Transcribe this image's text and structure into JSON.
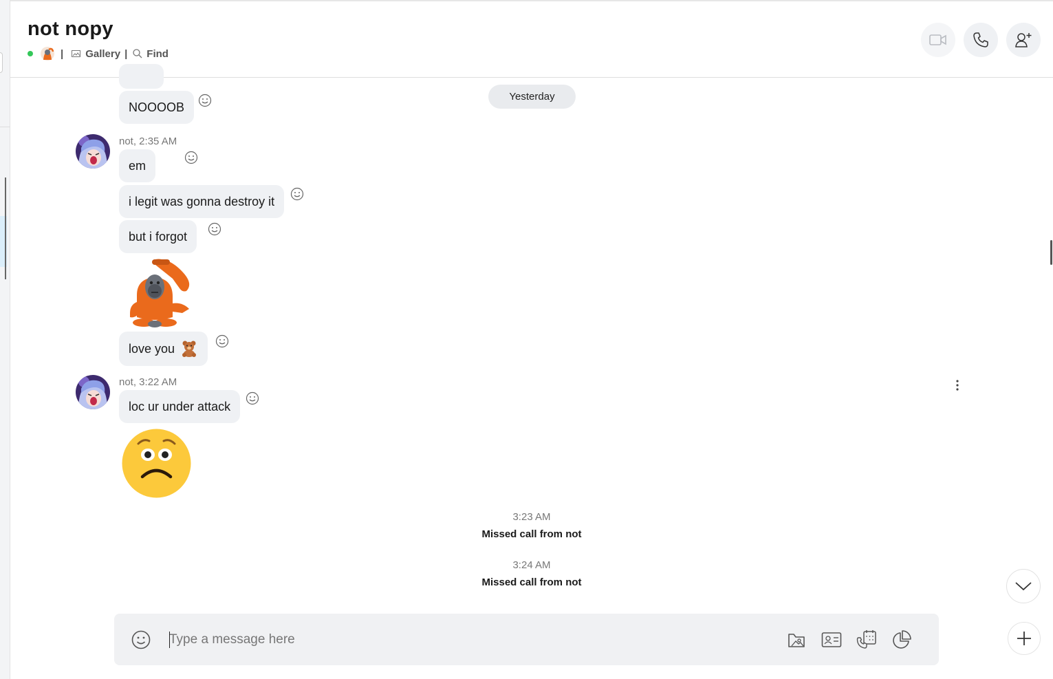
{
  "header": {
    "title": "not nopy",
    "separator": "|",
    "gallery_label": "Gallery",
    "find_label": "Find",
    "status_color": "#34c759",
    "buttons": [
      "video-call-icon",
      "audio-call-icon",
      "add-people-icon"
    ]
  },
  "chat": {
    "date_divider": "Yesterday",
    "messages": [
      {
        "text": "NOOOOB"
      },
      {
        "meta": "not, 2:35 AM"
      },
      {
        "text": "em"
      },
      {
        "text": "i legit was gonna destroy it"
      },
      {
        "text": "but i forgot"
      },
      {
        "sticker": "orangutan-sticker"
      },
      {
        "text": "love you",
        "emoji": "teddy-bear-emoji"
      },
      {
        "meta": "not, 3:22 AM"
      },
      {
        "text": "loc ur under attack"
      },
      {
        "sticker": "worried-face-emoji"
      }
    ],
    "system": [
      {
        "time": "3:23 AM",
        "text": "Missed call from not"
      },
      {
        "time": "3:24 AM",
        "text": "Missed call from not"
      }
    ]
  },
  "composer": {
    "placeholder": "Type a message here",
    "value": "",
    "icons": [
      "emoji-icon",
      "media-gallery-icon",
      "contact-card-icon",
      "schedule-call-icon",
      "poll-icon"
    ]
  },
  "colors": {
    "bubble": "#eff1f4",
    "accent_orange": "#ea6a1c",
    "online": "#34c759"
  }
}
